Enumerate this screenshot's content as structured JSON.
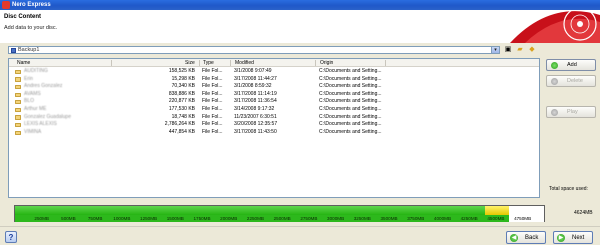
{
  "window": {
    "title": "Nero Express"
  },
  "header": {
    "title": "Disc Content",
    "subtitle": "Add data to your disc."
  },
  "compilation": {
    "name": "Backup1"
  },
  "columns": {
    "name": "Name",
    "size": "Size",
    "type": "Type",
    "modified": "Modified",
    "origin": "Origin"
  },
  "rows": [
    {
      "name": "AUDITING",
      "size": "158,525 KB",
      "type": "File Fol...",
      "modified": "3/1/2008 9:07:49",
      "origin": "C:\\Documents and Setting..."
    },
    {
      "name": "Erin",
      "size": "15,298 KB",
      "type": "File Fol...",
      "modified": "3/17/2008 11:44:27",
      "origin": "C:\\Documents and Setting..."
    },
    {
      "name": "Andres Gonzalez",
      "size": "70,340 KB",
      "type": "File Fol...",
      "modified": "3/1/2008 8:59:32",
      "origin": "C:\\Documents and Setting..."
    },
    {
      "name": "AVAMS",
      "size": "838,886 KB",
      "type": "File Fol...",
      "modified": "3/17/2008 11:14:19",
      "origin": "C:\\Documents and Setting..."
    },
    {
      "name": "BLO",
      "size": "220,877 KB",
      "type": "File Fol...",
      "modified": "3/17/2008 11:36:54",
      "origin": "C:\\Documents and Setting..."
    },
    {
      "name": "Arthur ME",
      "size": "177,530 KB",
      "type": "File Fol...",
      "modified": "3/14/2008 9:17:32",
      "origin": "C:\\Documents and Setting..."
    },
    {
      "name": "Gonzalez Guadalupe",
      "size": "18,748 KB",
      "type": "File Fol...",
      "modified": "11/23/2007 6:30:51",
      "origin": "C:\\Documents and Setting..."
    },
    {
      "name": "LEXIS ALEXIS",
      "size": "2,786,264 KB",
      "type": "File Fol...",
      "modified": "3/20/2008 12:35:57",
      "origin": "C:\\Documents and Setting..."
    },
    {
      "name": "VIMINA",
      "size": "447,854 KB",
      "type": "File Fol...",
      "modified": "3/17/2008 11:43:50",
      "origin": "C:\\Documents and Setting..."
    }
  ],
  "side": {
    "add": "Add",
    "delete": "Delete",
    "play": "Play",
    "total_label": "Total space used:",
    "total_value": "4624MB"
  },
  "capacity": {
    "used_mb": 4624,
    "ticks": [
      "250MB",
      "500MB",
      "750MB",
      "1000MB",
      "1250MB",
      "1500MB",
      "1750MB",
      "2000MB",
      "2250MB",
      "2500MB",
      "2750MB",
      "3000MB",
      "3250MB",
      "3500MB",
      "3750MB",
      "4000MB",
      "4250MB",
      "4500MB",
      "4750MB"
    ]
  },
  "nav": {
    "back": "Back",
    "next": "Next",
    "help": "?"
  },
  "colors": {
    "accent": "#2a6de0",
    "bar_green": "#2db81c",
    "bar_yellow": "#f2dc2a"
  }
}
